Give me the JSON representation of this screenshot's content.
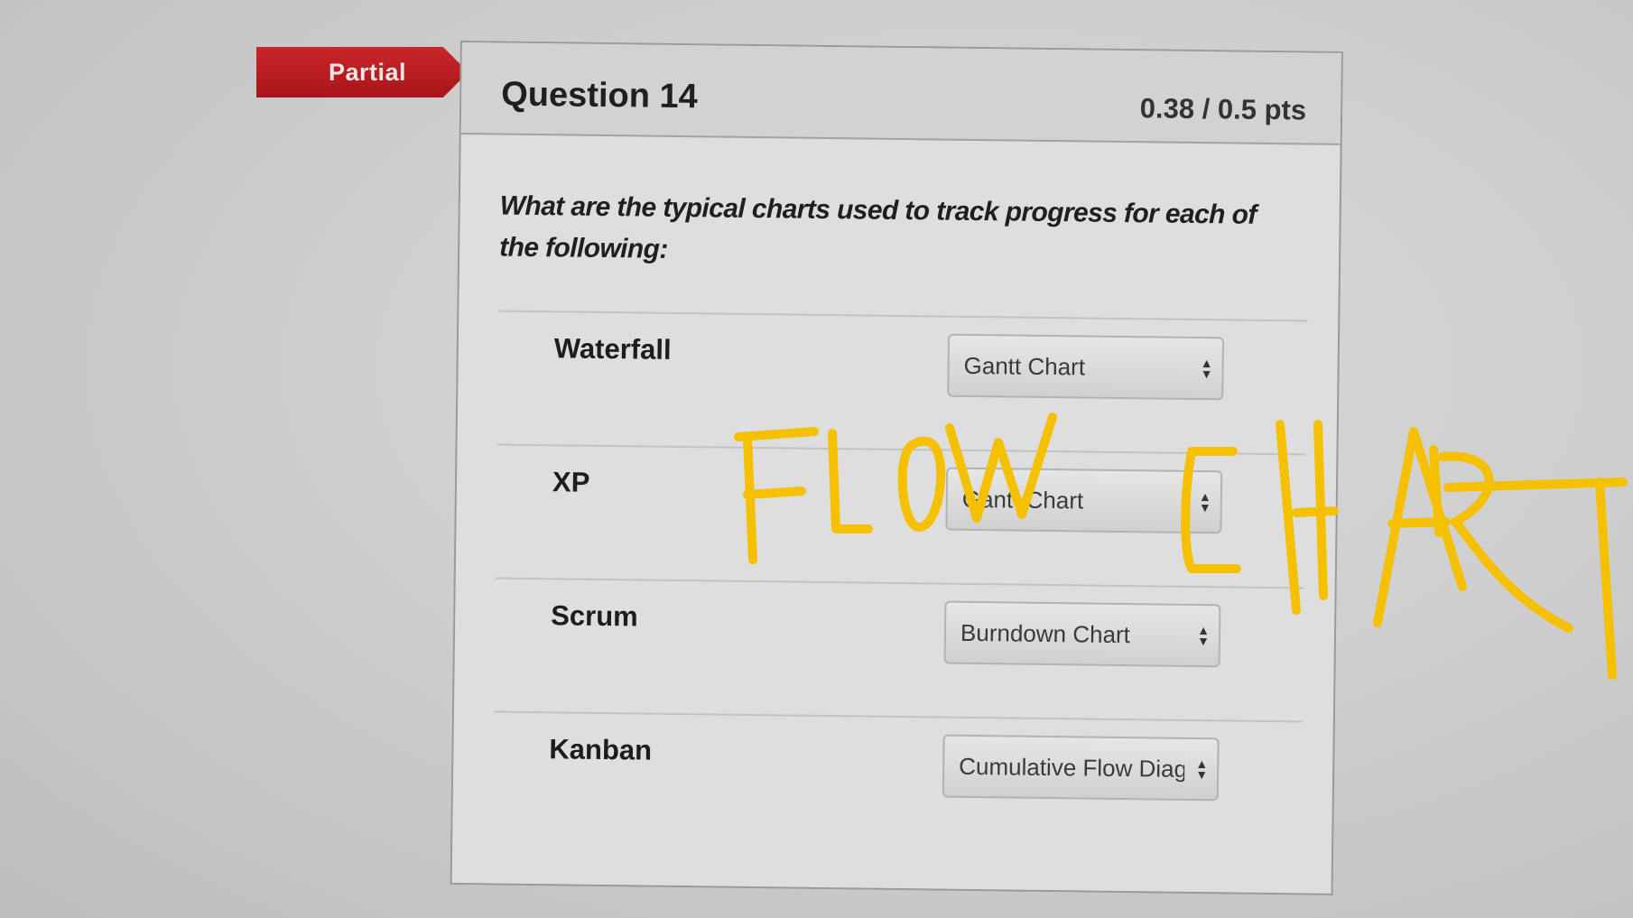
{
  "status": {
    "label": "Partial",
    "color": "#b51d21"
  },
  "question": {
    "title": "Question 14",
    "points": "0.38 / 0.5 pts",
    "prompt": "What are the typical charts used to track progress for each of the following:"
  },
  "matches": [
    {
      "label": "Waterfall",
      "selected": "Gantt Chart"
    },
    {
      "label": "XP",
      "selected": "Gantt Chart"
    },
    {
      "label": "Scrum",
      "selected": "Burndown Chart"
    },
    {
      "label": "Kanban",
      "selected": "Cumulative Flow Diagr"
    }
  ],
  "annotation": {
    "text": "FLOW CHART",
    "color": "#f5c000"
  }
}
